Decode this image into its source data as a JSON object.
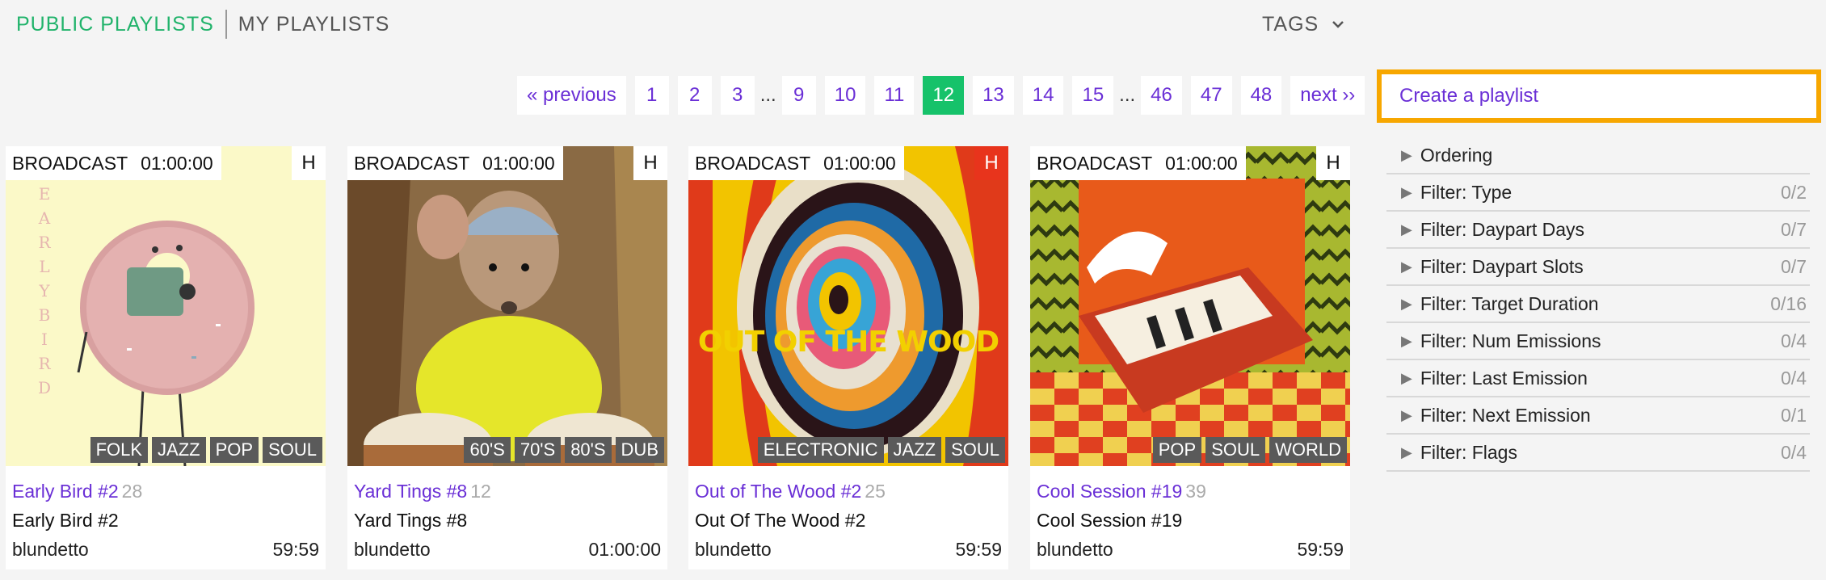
{
  "nav": {
    "public": "PUBLIC PLAYLISTS",
    "mine": "MY PLAYLISTS",
    "tags": "TAGS"
  },
  "pagination": {
    "previous": "« previous",
    "next": "next ››",
    "pages": [
      "1",
      "2",
      "3",
      "...",
      "9",
      "10",
      "11",
      "12",
      "13",
      "14",
      "15",
      "...",
      "46",
      "47",
      "48"
    ],
    "current": "12"
  },
  "cards": [
    {
      "broadcast": "BROADCAST",
      "duration": "01:00:00",
      "badge": "H",
      "genres": [
        "FOLK",
        "JAZZ",
        "POP",
        "SOUL"
      ],
      "title": "Early Bird #2",
      "count": "28",
      "subtitle": "Early Bird #2",
      "author": "blundetto",
      "length": "59:59",
      "art_text": "EARLY BIRD"
    },
    {
      "broadcast": "BROADCAST",
      "duration": "01:00:00",
      "badge": "H",
      "genres": [
        "60'S",
        "70'S",
        "80'S",
        "DUB"
      ],
      "title": "Yard Tings #8",
      "count": "12",
      "subtitle": "Yard Tings #8",
      "author": "blundetto",
      "length": "01:00:00"
    },
    {
      "broadcast": "BROADCAST",
      "duration": "01:00:00",
      "badge": "H",
      "genres": [
        "ELECTRONIC",
        "JAZZ",
        "SOUL"
      ],
      "title": "Out of The Wood #2",
      "count": "25",
      "subtitle": "Out Of The Wood #2",
      "author": "blundetto",
      "length": "59:59",
      "art_text": "OUT OF THE WOOD"
    },
    {
      "broadcast": "BROADCAST",
      "duration": "01:00:00",
      "badge": "H",
      "genres": [
        "POP",
        "SOUL",
        "WORLD"
      ],
      "title": "Cool Session #19",
      "count": "39",
      "subtitle": "Cool Session #19",
      "author": "blundetto",
      "length": "59:59"
    }
  ],
  "sidebar": {
    "create": "Create a playlist",
    "filters": [
      {
        "label": "Ordering",
        "count": ""
      },
      {
        "label": "Filter: Type",
        "count": "0/2"
      },
      {
        "label": "Filter: Daypart Days",
        "count": "0/7"
      },
      {
        "label": "Filter: Daypart Slots",
        "count": "0/7"
      },
      {
        "label": "Filter: Target Duration",
        "count": "0/16"
      },
      {
        "label": "Filter: Num Emissions",
        "count": "0/4"
      },
      {
        "label": "Filter: Last Emission",
        "count": "0/4"
      },
      {
        "label": "Filter: Next Emission",
        "count": "0/1"
      },
      {
        "label": "Filter: Flags",
        "count": "0/4"
      }
    ]
  },
  "colors": {
    "accent_green": "#21b36b",
    "link_purple": "#6a2fd6",
    "highlight_orange": "#f7a700",
    "badge_red": "#e8341c"
  }
}
